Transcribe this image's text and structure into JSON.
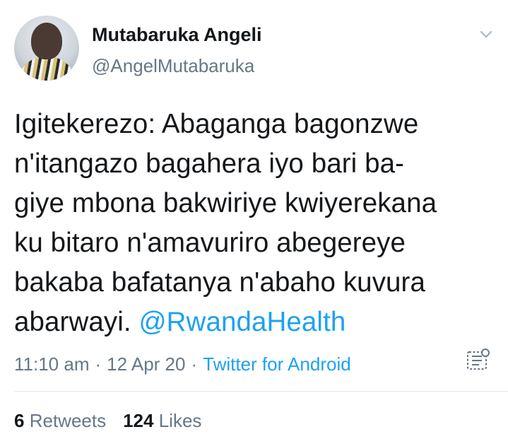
{
  "author": {
    "display_name": "Mutabaruka Angeli",
    "handle": "@AngelMutabaruka"
  },
  "tweet": {
    "text": "Igitekerezo: Abaganga bagonzwe\nn'itangazo bagahera iyo bari ba-\ngiye mbona bakwiriye kwiyerekana\nku bitaro n'amavuriro abegereye\nbakaba bafatanya n'abaho kuvura\nabarwayi. ",
    "mention": "@RwandaHealth"
  },
  "meta": {
    "time": "11:10 am",
    "separator": "·",
    "date": "12 Apr 20",
    "source": "Twitter for Android"
  },
  "stats": {
    "retweets_count": "6",
    "retweets_label": "Retweets",
    "likes_count": "124",
    "likes_label": "Likes"
  },
  "icons": {
    "menu": "chevron-down-icon",
    "analytics": "tweet-activity-icon"
  }
}
